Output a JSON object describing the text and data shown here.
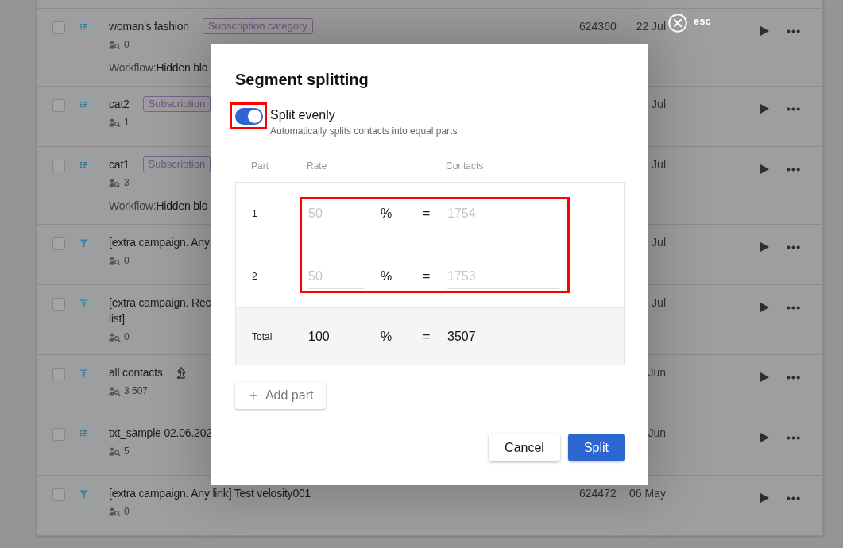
{
  "list": {
    "rows": [
      {
        "kind": "list",
        "checked": false,
        "title": "woman's fashion",
        "tag": "Subscription category",
        "marked": false,
        "count": "0",
        "workflow": {
          "label": "Workflow:",
          "value": "Hidden blo"
        },
        "id": "624360",
        "date": "22 Jul"
      },
      {
        "kind": "list",
        "checked": false,
        "title": "cat2",
        "tag": "Subscription",
        "marked": false,
        "count": "1",
        "date": "Jul"
      },
      {
        "kind": "list",
        "checked": false,
        "title": "cat1",
        "tag": "Subscription",
        "marked": false,
        "count": "3",
        "workflow": {
          "label": "Workflow:",
          "value": "Hidden blo"
        },
        "date": "Jul"
      },
      {
        "kind": "filter",
        "checked": false,
        "title": "[extra campaign. Any",
        "marked": false,
        "count": "0",
        "date": "Jul"
      },
      {
        "kind": "filter",
        "checked": false,
        "title": "[extra campaign. Rec\nlist]",
        "marked": false,
        "count": "0",
        "date": "Jul"
      },
      {
        "kind": "filter",
        "checked": false,
        "title": "all contacts",
        "marked": true,
        "count": "3 507",
        "date": "Jun"
      },
      {
        "kind": "list",
        "checked": false,
        "title": "txt_sample 02.06.202",
        "marked": false,
        "count": "5",
        "date": "Jun"
      },
      {
        "kind": "filter",
        "checked": false,
        "title": "[extra campaign. Any link] Test velosity001",
        "marked": false,
        "count": "0",
        "id": "624472",
        "date": "06 May"
      }
    ]
  },
  "close_button": {
    "label": "esc"
  },
  "dialog": {
    "title": "Segment splitting",
    "toggle": {
      "label": "Split evenly",
      "description": "Automatically splits contacts into equal parts",
      "on": true,
      "highlighted": true
    },
    "table": {
      "columns": [
        "Part",
        "Rate",
        "Contacts"
      ],
      "highlighted": true,
      "parts": [
        {
          "part": "1",
          "rate": "50",
          "unit": "%",
          "equals": "=",
          "contacts": "1754",
          "disabled": true
        },
        {
          "part": "2",
          "rate": "50",
          "unit": "%",
          "equals": "=",
          "contacts": "1753",
          "disabled": true
        }
      ],
      "total": {
        "label": "Total",
        "rate": "100",
        "unit": "%",
        "equals": "=",
        "contacts": "3507"
      }
    },
    "add_button": {
      "icon": "+",
      "label": "Add part"
    },
    "buttons": [
      {
        "label": "Cancel",
        "kind": "secondary"
      },
      {
        "label": "Split",
        "kind": "primary"
      }
    ]
  }
}
